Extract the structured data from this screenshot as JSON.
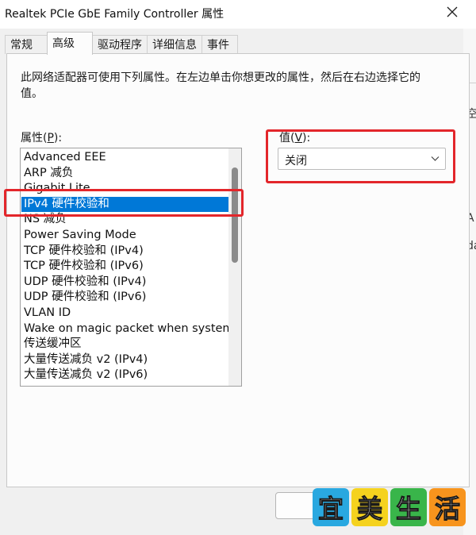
{
  "window": {
    "title": "Realtek PCIe GbE Family Controller 属性"
  },
  "tabs": [
    {
      "label": "常规",
      "active": false
    },
    {
      "label": "高级",
      "active": true
    },
    {
      "label": "驱动程序",
      "active": false
    },
    {
      "label": "详细信息",
      "active": false
    },
    {
      "label": "事件",
      "active": false
    }
  ],
  "advanced": {
    "description": "此网络适配器可使用下列属性。在左边单击你想更改的属性，然后在右边选择它的值。",
    "property_label_prefix": "属性(",
    "property_label_key": "P",
    "property_label_suffix": "):",
    "value_label_prefix": "值(",
    "value_label_key": "V",
    "value_label_suffix": "):",
    "selected_value": "关闭",
    "properties": [
      "Advanced EEE",
      "ARP 减负",
      "Gigabit Lite",
      "IPv4 硬件校验和",
      "NS 减负",
      "Power Saving Mode",
      "TCP 硬件校验和 (IPv4)",
      "TCP 硬件校验和 (IPv6)",
      "UDP 硬件校验和 (IPv4)",
      "UDP 硬件校验和 (IPv6)",
      "VLAN ID",
      "Wake on magic packet when system",
      "传送缓冲区",
      "大量传送减负 v2 (IPv4)",
      "大量传送减负 v2 (IPv6)"
    ],
    "selected_index": 3
  },
  "background_fragments": {
    "frag1": "空",
    "frag2": "A",
    "frag3": "da"
  },
  "watermark": {
    "chars": [
      "宜",
      "美",
      "生",
      "活"
    ],
    "colors": [
      "#29a8e0",
      "#f5d21e",
      "#39b54a",
      "#f7941d"
    ]
  },
  "colors": {
    "selection": "#0078d7",
    "highlight_box": "#e3262b"
  }
}
